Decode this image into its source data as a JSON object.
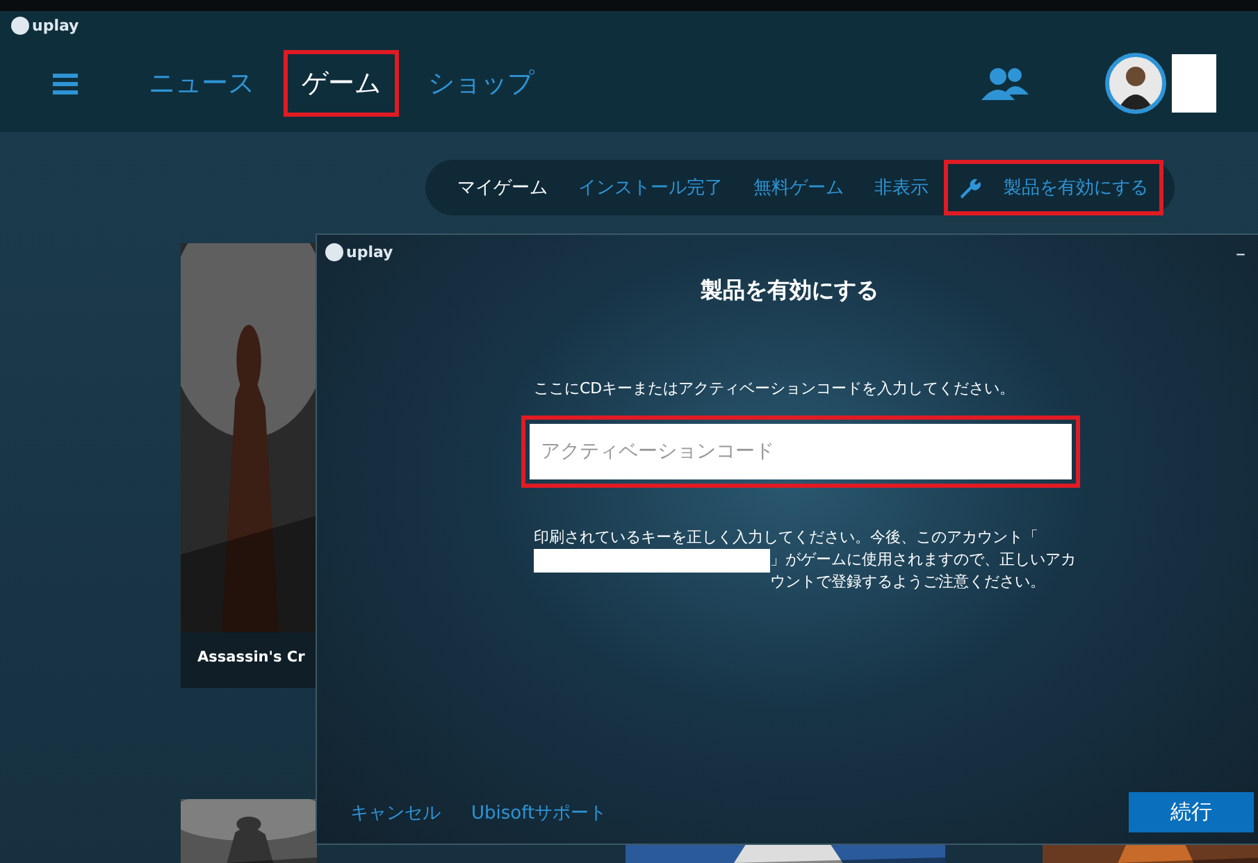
{
  "app": {
    "logo": "uplay"
  },
  "nav": [
    {
      "label": "ニュース",
      "selected": false,
      "highlighted": false
    },
    {
      "label": "ゲーム",
      "selected": true,
      "highlighted": true
    },
    {
      "label": "ショップ",
      "selected": false,
      "highlighted": false
    }
  ],
  "subnav": [
    {
      "label": "マイゲーム",
      "selected": true,
      "kind": "tab",
      "highlighted": false
    },
    {
      "label": "インストール完了",
      "selected": false,
      "kind": "tab",
      "highlighted": false
    },
    {
      "label": "無料ゲーム",
      "selected": false,
      "kind": "tab",
      "highlighted": false
    },
    {
      "label": "非表示",
      "selected": false,
      "kind": "tab",
      "highlighted": false
    },
    {
      "label": "製品を有効にする",
      "selected": false,
      "kind": "action",
      "highlighted": true
    }
  ],
  "game_card": {
    "caption": "Assassin's Cr"
  },
  "dialog": {
    "logo": "uplay",
    "minimize": "–",
    "title": "製品を有効にする",
    "prompt": "ここにCDキーまたはアクティベーションコードを入力してください。",
    "field": {
      "placeholder": "アクティベーションコード",
      "highlighted": true
    },
    "notice": {
      "before": "印刷されているキーを正しく入力してください。今後、このアカウント「",
      "after": "」がゲームに使用されますので、正しいアカウントで登録するようご注意ください。"
    },
    "links": [
      "キャンセル",
      "Ubisoftサポート"
    ],
    "primary": "続行"
  }
}
